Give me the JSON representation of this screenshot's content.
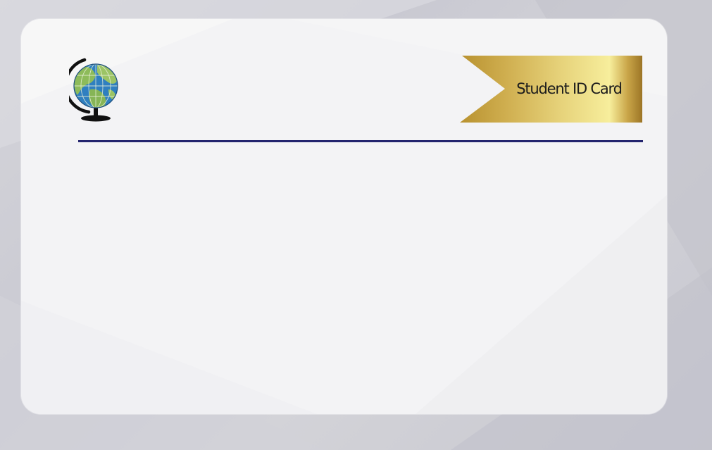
{
  "card": {
    "title": "Student ID Card",
    "logo_icon": "globe-icon"
  },
  "colors": {
    "background": "#cdcdd4",
    "card": "#f3f3f5",
    "divider": "#23246e",
    "ribbon_gold_dark": "#b8912f",
    "ribbon_gold_light": "#f7ee9c",
    "title_text": "#1c1c1c"
  }
}
